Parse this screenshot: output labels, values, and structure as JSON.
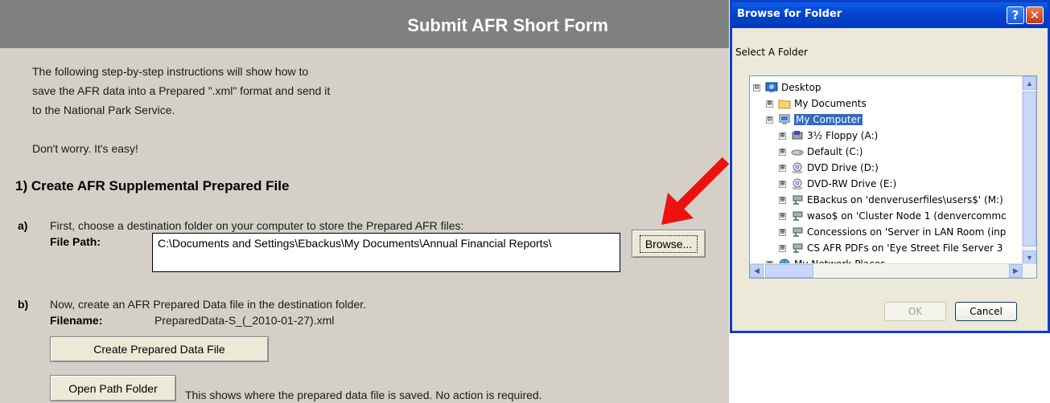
{
  "form": {
    "title": "Submit AFR Short Form",
    "intro": [
      "The following step-by-step instructions will show how to",
      "save the AFR data into a Prepared \".xml\" format and send it",
      "to the National Park Service."
    ],
    "reassure": "Don't worry.  It's easy!",
    "section1_title": "1)  Create AFR Supplemental Prepared File",
    "step_a": {
      "letter": "a)",
      "text": "First, choose a destination folder on your computer to store the Prepared AFR files:",
      "field_label": "File Path:",
      "path_value": "C:\\Documents and Settings\\Ebackus\\My Documents\\Annual Financial Reports\\",
      "browse_label": "Browse..."
    },
    "step_b": {
      "letter": "b)",
      "text": "Now, create an AFR Prepared Data file in the destination folder.",
      "field_label": "Filename:",
      "filename_value": "PreparedData-S_(_2010-01-27).xml",
      "create_label": "Create Prepared Data File",
      "open_label": "Open Path Folder",
      "open_note": "This shows where the prepared data file is saved.  No action is required."
    },
    "arrow_color": "#ee1111"
  },
  "dialog": {
    "title": "Browse for Folder",
    "help_glyph": "?",
    "close_glyph": "✕",
    "prompt": "Select A Folder",
    "tree": [
      {
        "label": "Desktop",
        "icon": "desktop-icon",
        "expander": "⊟"
      },
      {
        "label": "My Documents",
        "icon": "folder-icon",
        "expander": "⊞"
      },
      {
        "label": "My Computer",
        "icon": "computer-icon",
        "expander": "⊟",
        "selected": true
      },
      {
        "label": "3½ Floppy (A:)",
        "icon": "floppy-drive-icon",
        "expander": "⊞"
      },
      {
        "label": "Default (C:)",
        "icon": "hard-drive-icon",
        "expander": "⊞"
      },
      {
        "label": "DVD Drive (D:)",
        "icon": "dvd-drive-icon",
        "expander": "⊞"
      },
      {
        "label": "DVD-RW Drive (E:)",
        "icon": "dvd-rw-drive-icon",
        "expander": "⊞"
      },
      {
        "label": "EBackus on 'denveruserfiles\\users$' (M:)",
        "icon": "network-drive-icon",
        "expander": "⊞"
      },
      {
        "label": "waso$ on 'Cluster Node 1 (denvercommc",
        "icon": "network-drive-icon",
        "expander": "⊞"
      },
      {
        "label": "Concessions on 'Server in LAN Room (inp",
        "icon": "network-drive-icon",
        "expander": "⊞"
      },
      {
        "label": "CS AFR PDFs on 'Eye Street File Server 3",
        "icon": "network-drive-icon",
        "expander": "⊞"
      },
      {
        "label": "My Network Places",
        "icon": "network-places-icon",
        "expander": "⊞"
      }
    ],
    "ok_label": "OK",
    "cancel_label": "Cancel",
    "title_color": "#0545d0",
    "selection_color": "#316ac5"
  }
}
